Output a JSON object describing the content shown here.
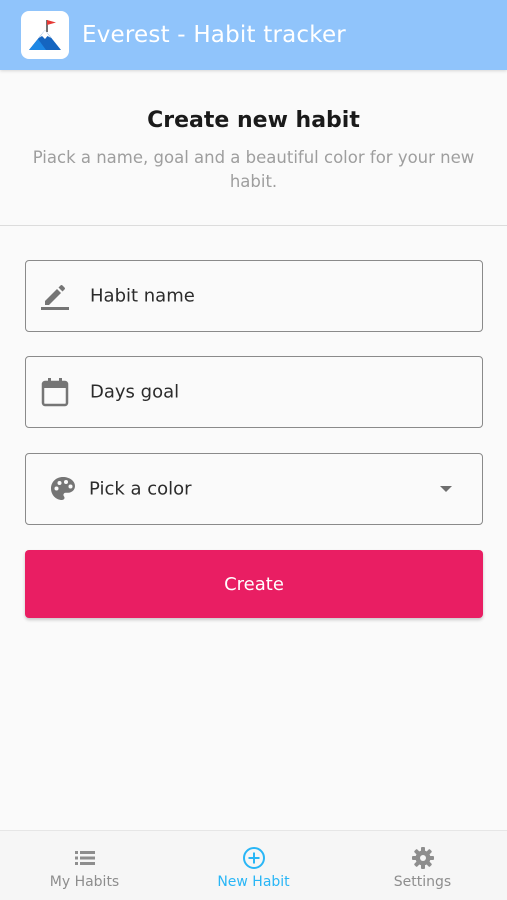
{
  "app_bar": {
    "title": "Everest - Habit tracker",
    "logo_icon": "mountain-flag-logo",
    "background_color": "#90c4fb"
  },
  "header": {
    "title": "Create new habit",
    "subtitle": "Piack a name, goal and a beautiful color for your new habit."
  },
  "form": {
    "habit_name": {
      "label": "Habit name",
      "icon": "pencil-icon"
    },
    "days_goal": {
      "label": "Days goal",
      "icon": "calendar-icon"
    },
    "color_picker": {
      "label": "Pick a color",
      "icon": "palette-icon"
    },
    "create_button": {
      "label": "Create",
      "color": "#e91e63"
    }
  },
  "bottom_nav": {
    "items": [
      {
        "label": "My Habits",
        "icon": "list-icon",
        "active": false
      },
      {
        "label": "New Habit",
        "icon": "add-circle-icon",
        "active": true
      },
      {
        "label": "Settings",
        "icon": "gear-icon",
        "active": false
      }
    ],
    "active_color": "#29b6f6",
    "inactive_color": "#8e8e8e"
  }
}
